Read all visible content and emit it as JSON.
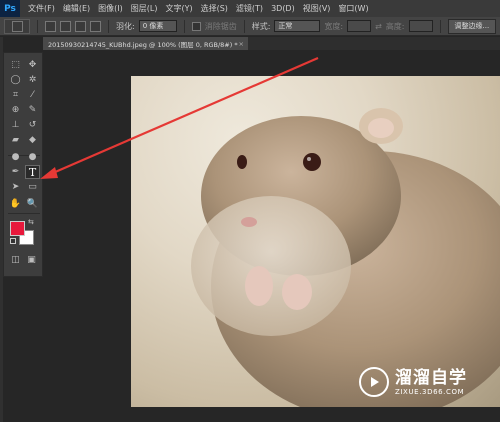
{
  "app": {
    "logo": "Ps"
  },
  "menu": {
    "items": [
      "文件(F)",
      "编辑(E)",
      "图像(I)",
      "图层(L)",
      "文字(Y)",
      "选择(S)",
      "滤镜(T)",
      "3D(D)",
      "视图(V)",
      "窗口(W)"
    ]
  },
  "options": {
    "feather_label": "羽化:",
    "feather_value": "0 像素",
    "antialias_label": "消除锯齿",
    "style_label": "样式:",
    "style_value": "正常",
    "width_label": "宽度:",
    "height_label": "高度:",
    "refine_edge_button": "调整边缘..."
  },
  "document": {
    "tab_title": "20150930214745_KUBhd.jpeg @ 100% (图层 0, RGB/8#) *",
    "close_glyph": "×"
  },
  "tools": [
    {
      "name": "marquee-icon",
      "glyph": "⬚"
    },
    {
      "name": "move-icon",
      "glyph": "✥"
    },
    {
      "name": "lasso-icon",
      "glyph": "◯"
    },
    {
      "name": "magic-wand-icon",
      "glyph": "✲"
    },
    {
      "name": "crop-icon",
      "glyph": "⌗"
    },
    {
      "name": "eyedropper-icon",
      "glyph": "⁄"
    },
    {
      "name": "healing-brush-icon",
      "glyph": "⊕"
    },
    {
      "name": "brush-icon",
      "glyph": "✎"
    },
    {
      "name": "clone-stamp-icon",
      "glyph": "⊥"
    },
    {
      "name": "history-brush-icon",
      "glyph": "↺"
    },
    {
      "name": "eraser-icon",
      "glyph": "▰"
    },
    {
      "name": "paint-bucket-icon",
      "glyph": "◆"
    },
    {
      "name": "blur-icon",
      "glyph": "●"
    },
    {
      "name": "dodge-icon",
      "glyph": "●"
    },
    {
      "name": "pen-icon",
      "glyph": "✒"
    },
    {
      "name": "type-tool-icon",
      "glyph": "T"
    },
    {
      "name": "path-selection-icon",
      "glyph": "➤"
    },
    {
      "name": "rectangle-tool-icon",
      "glyph": "▭"
    },
    {
      "name": "hand-icon",
      "glyph": "✋"
    },
    {
      "name": "zoom-icon",
      "glyph": "🔍"
    }
  ],
  "colors": {
    "foreground": "#e8193c",
    "background": "#ffffff",
    "annotation_arrow": "#e53935"
  },
  "watermark": {
    "title": "溜溜自学",
    "url": "ZIXUE.3D66.COM"
  }
}
